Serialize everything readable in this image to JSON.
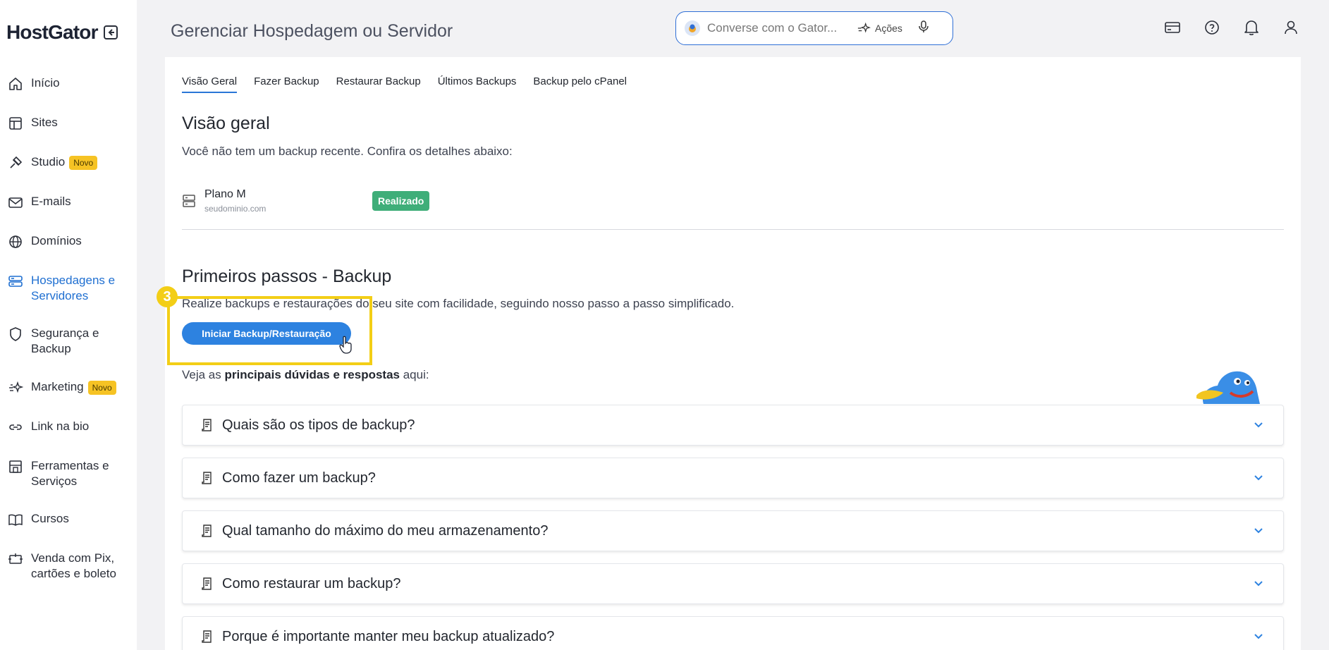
{
  "brand": {
    "logo": "HostGator"
  },
  "sidebar": {
    "items": [
      {
        "label": "Início",
        "icon": "home-icon"
      },
      {
        "label": "Sites",
        "icon": "layout-icon"
      },
      {
        "label": "Studio",
        "icon": "brush-icon",
        "badge": "Novo"
      },
      {
        "label": "E-mails",
        "icon": "mail-icon"
      },
      {
        "label": "Domínios",
        "icon": "globe-icon"
      },
      {
        "label": "Hospedagens e Servidores",
        "icon": "server-icon",
        "active": true
      },
      {
        "label": "Segurança e Backup",
        "icon": "shield-icon"
      },
      {
        "label": "Marketing",
        "icon": "sparkle-icon",
        "badge": "Novo"
      },
      {
        "label": "Link na bio",
        "icon": "link-icon"
      },
      {
        "label": "Ferramentas e Serviços",
        "icon": "tools-icon"
      },
      {
        "label": "Cursos",
        "icon": "book-icon"
      },
      {
        "label": "Venda com Pix, cartões e boleto",
        "icon": "payment-icon"
      }
    ]
  },
  "header": {
    "title": "Gerenciar Hospedagem ou Servidor",
    "search_placeholder": "Converse com o Gator...",
    "actions_label": "Ações"
  },
  "tabs": [
    {
      "label": "Visão Geral",
      "active": true
    },
    {
      "label": "Fazer Backup"
    },
    {
      "label": "Restaurar Backup"
    },
    {
      "label": "Últimos Backups"
    },
    {
      "label": "Backup pelo cPanel"
    }
  ],
  "overview": {
    "title": "Visão geral",
    "description": "Você não tem um backup recente. Confira os detalhes abaixo:",
    "plan_name": "Plano M",
    "plan_domain": "seudominio.com",
    "status": "Realizado"
  },
  "first_steps": {
    "title": "Primeiros passos - Backup",
    "description": "Realize backups e restaurações do seu site com facilidade, seguindo nosso passo a passo simplificado.",
    "button": "Iniciar Backup/Restauração",
    "step_number": "3"
  },
  "faq": {
    "intro_prefix": "Veja as ",
    "intro_bold": "principais dúvidas e respostas",
    "intro_suffix": " aqui:",
    "questions": [
      "Quais são os tipos de backup?",
      "Como fazer um backup?",
      "Qual tamanho do máximo do meu armazenamento?",
      "Como restaurar um backup?",
      "Porque é importante manter meu backup atualizado?"
    ]
  },
  "colors": {
    "accent": "#2d82e0",
    "success": "#3fae79",
    "highlight": "#f3ce16",
    "badge": "#f6c324"
  }
}
